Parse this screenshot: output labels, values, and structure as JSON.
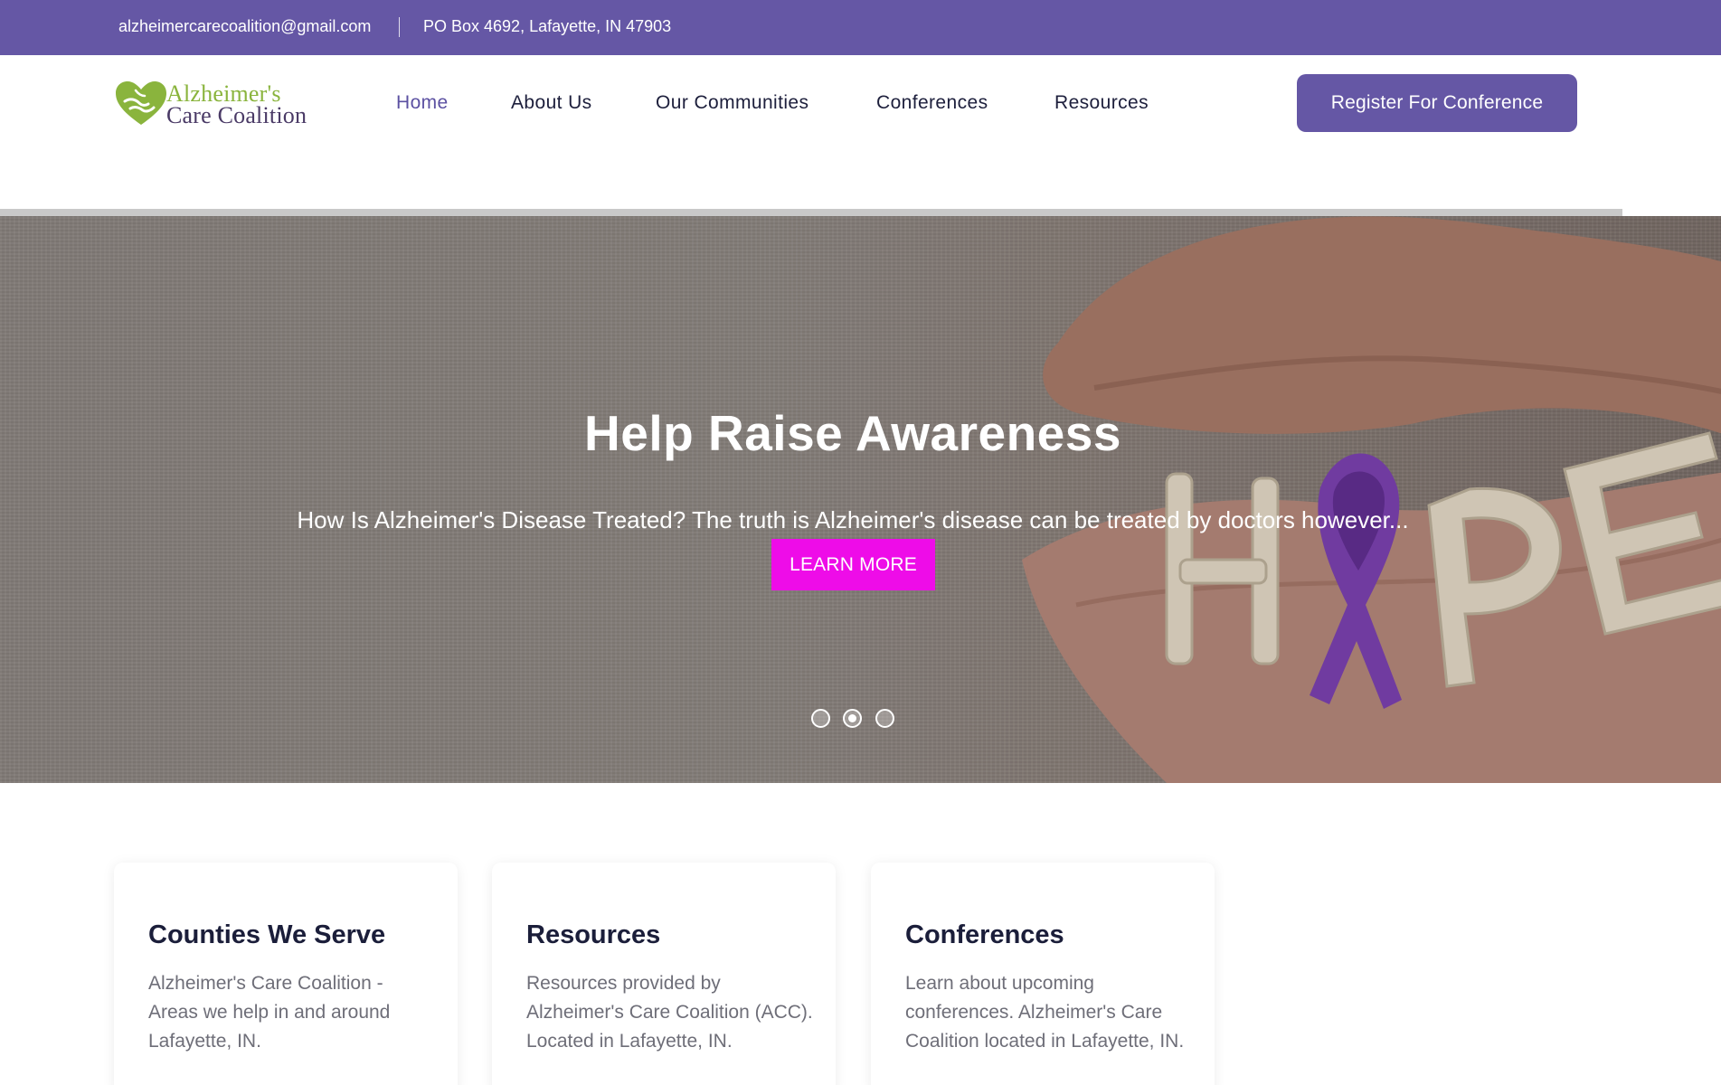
{
  "topbar": {
    "email": "alzheimercarecoalition@gmail.com",
    "address": "PO Box 4692, Lafayette, IN 47903"
  },
  "logo": {
    "line1": "Alzheimer's",
    "line2": "Care Coalition",
    "colors": {
      "green": "#8ab43d",
      "purple": "#4a3a66"
    }
  },
  "nav": {
    "items": [
      {
        "label": "Home",
        "active": true
      },
      {
        "label": "About Us",
        "active": false
      },
      {
        "label": "Our Communities",
        "active": false
      },
      {
        "label": "Conferences",
        "active": false
      },
      {
        "label": "Resources",
        "active": false
      }
    ],
    "cta_label": "Register For Conference"
  },
  "hero": {
    "title": "Help Raise Awareness",
    "subtitle": "How Is Alzheimer's Disease Treated? The truth is Alzheimer's disease can be treated by doctors however...",
    "button_label": "LEARN MORE",
    "slides_count": 3,
    "active_slide": 2,
    "image_text": "HOPE"
  },
  "cards": [
    {
      "title": "Counties We Serve",
      "text": "Alzheimer's Care Coalition - Areas we help in and around Lafayette, IN."
    },
    {
      "title": "Resources",
      "text": "Resources provided by Alzheimer's Care Coalition (ACC). Located in Lafayette, IN."
    },
    {
      "title": "Conferences",
      "text": "Learn about upcoming conferences. Alzheimer's Care Coalition located in Lafayette, IN."
    }
  ],
  "colors": {
    "brand_purple": "#6557a5",
    "accent_magenta": "#ee0ce8",
    "ribbon_purple": "#7a3fb2"
  }
}
